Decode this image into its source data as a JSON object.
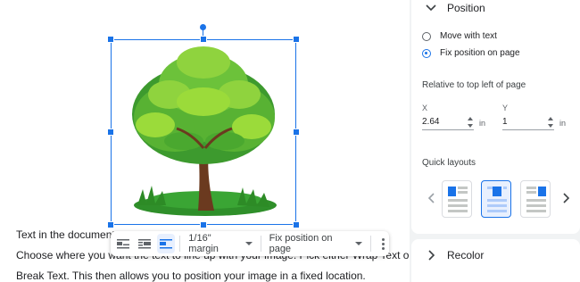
{
  "document": {
    "lines": [
      "Text in the document c",
      "Choose where you want the text to line up with your image. Pick either Wrap Text or",
      "Break Text. This then allows you to position your image in a fixed location."
    ]
  },
  "image_toolbar": {
    "margin_value": "1/16\" margin",
    "position_value": "Fix position on page"
  },
  "panel": {
    "position": {
      "title": "Position",
      "options": [
        "Move with text",
        "Fix position on page"
      ],
      "selected_option": "Fix position on page",
      "relative_label": "Relative to top left of page",
      "x_label": "X",
      "x_value": "2.64",
      "x_unit": "in",
      "y_label": "Y",
      "y_value": "1",
      "y_unit": "in",
      "quick_layouts_label": "Quick layouts"
    },
    "recolor": {
      "title": "Recolor"
    }
  },
  "colors": {
    "accent": "#1a73e8",
    "selected_bg": "#e8f0fe",
    "panel_bg": "#f1f3f4",
    "leaf_light": "#9bdb3a",
    "leaf_dark": "#3d9a2e",
    "trunk": "#6b3a1f"
  },
  "icons": [
    "chevron-down-icon",
    "chevron-right-icon",
    "wrap-inline-icon",
    "wrap-text-icon",
    "break-text-icon",
    "more-vert-icon",
    "chevron-left-icon"
  ]
}
